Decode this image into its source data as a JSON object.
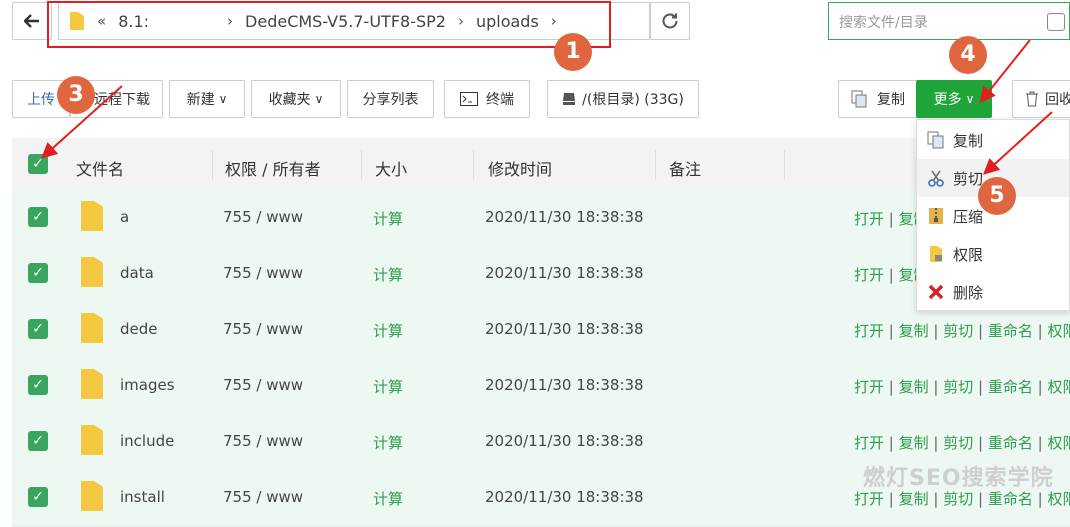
{
  "nav": {
    "path_root": "8.1:",
    "path_items": [
      "DedeCMS-V5.7-UTF8-SP2",
      "uploads"
    ],
    "search_placeholder": "搜索文件/目录"
  },
  "toolbar": {
    "upload": "上传",
    "remote_download": "远程下载",
    "new": "新建",
    "favorites": "收藏夹",
    "share_list": "分享列表",
    "terminal": "终端",
    "disk": "/(根目录) (33G)",
    "copy": "复制",
    "more": "更多",
    "recycle": "回收"
  },
  "table": {
    "headers": [
      "文件名",
      "权限 / 所有者",
      "大小",
      "修改时间",
      "备注"
    ],
    "rows": [
      {
        "name": "a",
        "perm": "755 / www",
        "size": "计算",
        "mtime": "2020/11/30 18:38:38",
        "ops": [
          "打开",
          "复制"
        ]
      },
      {
        "name": "data",
        "perm": "755 / www",
        "size": "计算",
        "mtime": "2020/11/30 18:38:38",
        "ops": [
          "打开",
          "复制"
        ]
      },
      {
        "name": "dede",
        "perm": "755 / www",
        "size": "计算",
        "mtime": "2020/11/30 18:38:38",
        "ops": [
          "打开",
          "复制",
          "剪切",
          "重命名",
          "权限"
        ]
      },
      {
        "name": "images",
        "perm": "755 / www",
        "size": "计算",
        "mtime": "2020/11/30 18:38:38",
        "ops": [
          "打开",
          "复制",
          "剪切",
          "重命名",
          "权限"
        ]
      },
      {
        "name": "include",
        "perm": "755 / www",
        "size": "计算",
        "mtime": "2020/11/30 18:38:38",
        "ops": [
          "打开",
          "复制",
          "剪切",
          "重命名",
          "权限"
        ]
      },
      {
        "name": "install",
        "perm": "755 / www",
        "size": "计算",
        "mtime": "2020/11/30 18:38:38",
        "ops": [
          "打开",
          "复制",
          "剪切",
          "重命名",
          "权限"
        ]
      }
    ]
  },
  "more_menu": {
    "items": [
      {
        "label": "复制",
        "icon": "copy-icon"
      },
      {
        "label": "剪切",
        "icon": "scissors-icon"
      },
      {
        "label": "压缩",
        "icon": "zip-icon"
      },
      {
        "label": "权限",
        "icon": "lock-folder-icon"
      },
      {
        "label": "删除",
        "icon": "delete-x-icon"
      }
    ]
  },
  "annotations": {
    "badges": [
      "1",
      "2",
      "3",
      "4",
      "5"
    ]
  },
  "watermark": "燃灯SEO搜索学院",
  "colors": {
    "accent": "#3aa55f",
    "annotation": "#e0663f",
    "box": "#e02020"
  }
}
